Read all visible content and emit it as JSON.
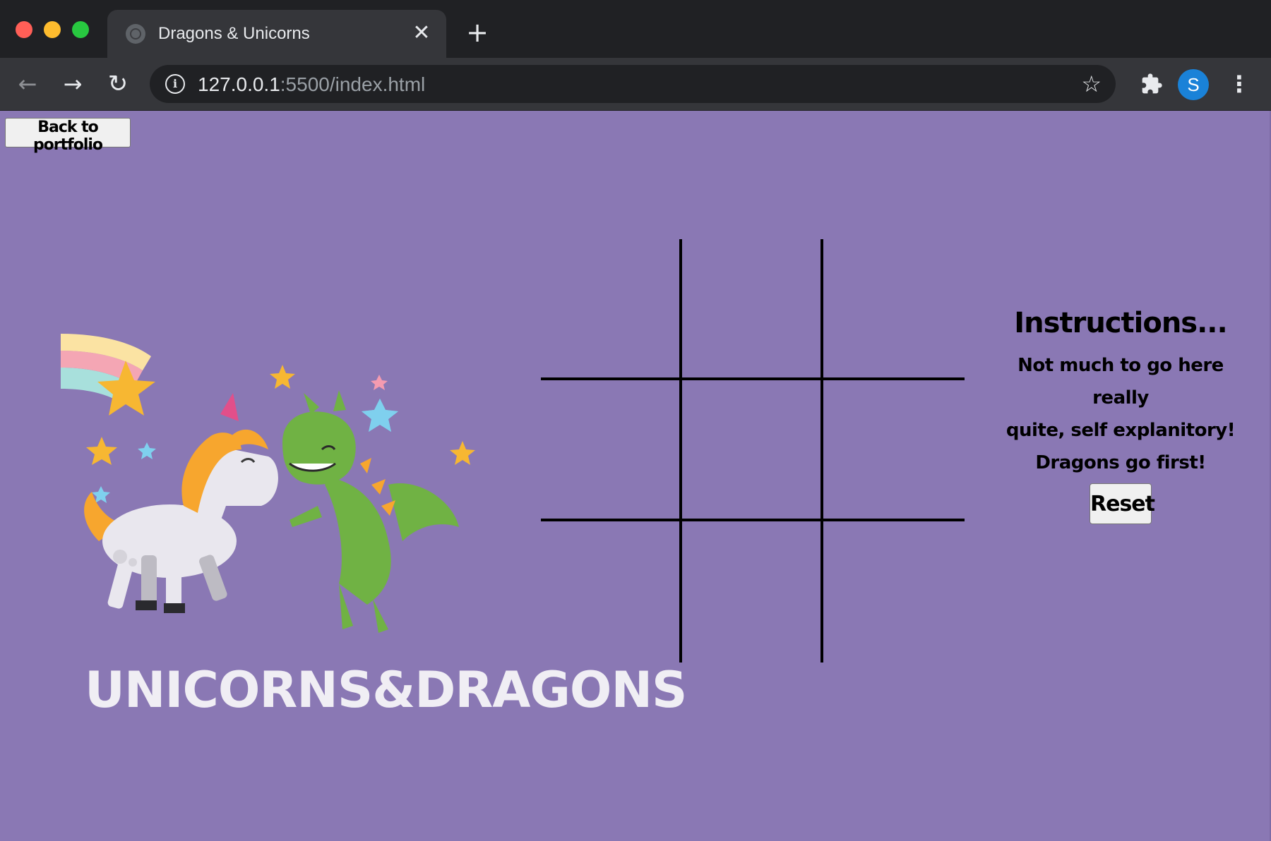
{
  "browser": {
    "tab_title": "Dragons & Unicorns",
    "url_host": "127.0.0.1",
    "url_path": ":5500/index.html",
    "avatar_letter": "S",
    "icons": {
      "back": "arrow-left-icon",
      "forward": "arrow-right-icon",
      "reload": "reload-icon",
      "info": "info-icon",
      "bookmark": "star-icon",
      "extensions": "puzzle-icon",
      "menu": "kebab-menu-icon",
      "close_tab": "close-icon",
      "new_tab": "plus-icon"
    },
    "colors": {
      "tabbar": "#202124",
      "toolbar": "#35363a",
      "avatar": "#1a82d8"
    }
  },
  "page": {
    "background": "#8a78b4",
    "back_button_label": "Back to portfolio",
    "logo_text": "UNICORNS&DRAGONS",
    "instructions": {
      "title": "Instructions...",
      "lines": [
        "Not much to go here really",
        "quite, self explanitory!",
        "Dragons go first!"
      ]
    },
    "reset_label": "Reset",
    "board": {
      "rows": 3,
      "cols": 3,
      "cells": [
        "",
        "",
        "",
        "",
        "",
        "",
        "",
        "",
        ""
      ]
    }
  }
}
